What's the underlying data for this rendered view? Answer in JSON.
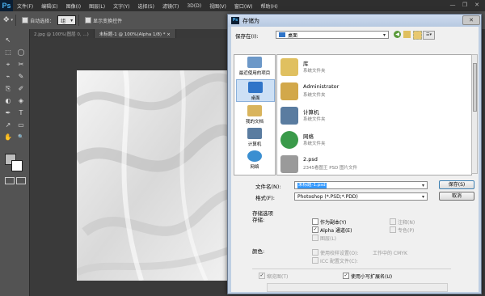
{
  "app": {
    "logo": "Ps",
    "menu": [
      "文件(F)",
      "编辑(E)",
      "图像(I)",
      "图层(L)",
      "文字(Y)",
      "选择(S)",
      "滤镜(T)",
      "3D(D)",
      "视图(V)",
      "窗口(W)",
      "帮助(H)"
    ],
    "window_controls": {
      "minimize": "—",
      "restore": "❐",
      "close": "✕"
    }
  },
  "options_bar": {
    "auto_select_label": "自动选择：",
    "auto_select_value": "组",
    "show_transform_label": "显示变换控件"
  },
  "document_tabs": [
    {
      "label": "2.jpg @ 100%(图层 0, ...)"
    },
    {
      "label": "未标题-1 @ 100%(Alpha 1/8) * ×"
    }
  ],
  "tools": [
    "↖",
    "⬚",
    "◯",
    "⌖",
    "✂",
    "⌁",
    "✎",
    "⎘",
    "✐",
    "◐",
    "◈",
    "✒",
    "T",
    "↗",
    "▭",
    "✋",
    "🔍"
  ],
  "dialog": {
    "title": "存储为",
    "icon": "Ps",
    "close": "✕",
    "save_in_label": "保存在(I):",
    "save_in_value": "桌面",
    "nav_icons": [
      "back-icon",
      "up-folder-icon",
      "new-folder-icon",
      "view-menu-icon"
    ],
    "places": [
      {
        "label": "最近使用的项目",
        "icon": "recent-icon",
        "color": "#6c98c8"
      },
      {
        "label": "桌面",
        "icon": "desktop-icon",
        "color": "#2f74c8"
      },
      {
        "label": "我的文档",
        "icon": "documents-icon",
        "color": "#d9b45c"
      },
      {
        "label": "计算机",
        "icon": "computer-icon",
        "color": "#5a7ca0"
      },
      {
        "label": "网络",
        "icon": "network-icon",
        "color": "#3b8fd1"
      }
    ],
    "files": [
      {
        "name": "库",
        "type": "系统文件夹",
        "icon": "library-icon",
        "color": "#e0c060"
      },
      {
        "name": "Administrator",
        "type": "系统文件夹",
        "icon": "user-folder-icon",
        "color": "#d2a84a"
      },
      {
        "name": "计算机",
        "type": "系统文件夹",
        "icon": "computer-icon",
        "color": "#5a7ca0"
      },
      {
        "name": "网络",
        "type": "系统文件夹",
        "icon": "network-icon",
        "color": "#3a9a4a"
      },
      {
        "name": "2.psd",
        "type": "2345看图王 PSD 图片文件",
        "icon": "psd-file-icon",
        "color": "#9a9a9a"
      }
    ],
    "filename_label": "文件名(N):",
    "filename_value": "未标题-1.psd",
    "format_label": "格式(F):",
    "format_value": "Photoshop (*.PSD;*.PDD)",
    "save_button": "保存(S)",
    "cancel_button": "取消",
    "save_options_title": "存储选项",
    "save_label": "存储:",
    "options": {
      "as_copy": "作为副本(Y)",
      "notes": "注释(N)",
      "alpha": "Alpha 通道(E)",
      "spot": "专色(P)",
      "layers": "图层(L)",
      "color_label": "颜色:",
      "proof": "使用校样设置(O):",
      "proof_value": "工作中的 CMYK",
      "icc": "ICC 配置文件(C):",
      "thumbnail": "缩览图(T)",
      "lowercase_ext": "使用小写扩展名(U)"
    },
    "checked": {
      "alpha": true,
      "lowercase_ext": true,
      "thumbnail": true
    }
  }
}
